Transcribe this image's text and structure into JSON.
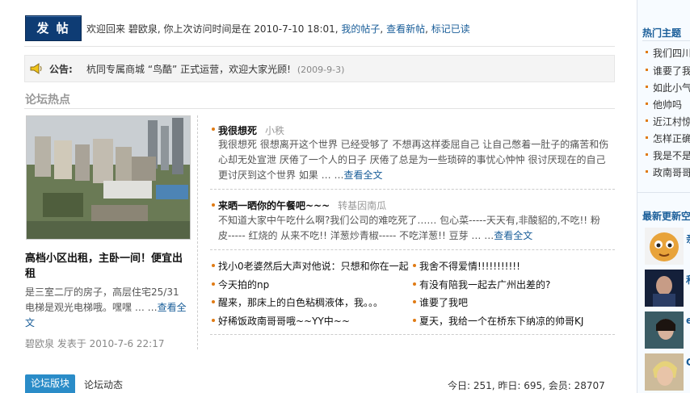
{
  "top": {
    "post_button": "发 帖",
    "welcome_prefix": "欢迎回来 碧欧泉, 你上次访问时间是在 2010-7-10 18:01,",
    "my_posts": "我的帖子",
    "new_posts": "查看新帖",
    "mark_read": "标记已读"
  },
  "announcement": {
    "label": "公告:",
    "text": "杭同专属商城 “鸟酷” 正式运营，欢迎大家光顾!",
    "date": "(2009-9-3)"
  },
  "hot": {
    "title": "论坛热点",
    "featured": {
      "title": "高档小区出租，主卧一间！便宜出租",
      "desc": "是三室二厅的房子，高层住宅25/31 电梯是观光电梯哦。嘿嘿 … …",
      "read_more": "查看全文",
      "meta": "碧欧泉 发表于 2010-7-6 22:17"
    },
    "articles": [
      {
        "title": "我很想死",
        "author": "小秩",
        "body": "我很想死 很想离开这个世界 已经受够了 不想再这样委屈自己 让自己憋着一肚子的痛苦和伤心却无处宣泄 厌倦了一个人的日子 厌倦了总是为一些琐碎的事忧心忡忡 很讨厌现在的自己 更讨厌到这个世界 如果 … …",
        "read_more": "查看全文"
      },
      {
        "title": "来晒一晒你的午餐吧~~~",
        "author": "转基因南瓜",
        "body": "不知道大家中午吃什么啊?我们公司的难吃死了…… 包心菜-----天天有,非酸貂的,不吃!! 粉皮----- 红烧的 从来不吃!! 洋葱炒青椒----- 不吃洋葱!! 豆芽 … …",
        "read_more": "查看全文"
      }
    ],
    "links_left": [
      "找小0老婆然后大声对他说：只想和你在一起",
      "今天拍的np",
      "醒来，那床上的白色粘稠液体，我。。。",
      "好稀饭政南哥哥哦~~YY中~~"
    ],
    "links_right": [
      "我舍不得爱情!!!!!!!!!!!",
      "有没有陪我一起去广州出差的?",
      "谁要了我吧",
      "夏天，我给一个在桥东下纳凉的帅哥KJ"
    ]
  },
  "footer": {
    "tab": "论坛版块",
    "news": "论坛动态",
    "stats": "今日: 251, 昨日: 695, 会员: 28707"
  },
  "sidebar": {
    "hot_topics_title": "热门主题",
    "hot_topics": [
      "我们四川",
      "谁要了我",
      "如此小气",
      "他帅吗",
      "近江村惊",
      "怎样正确",
      "我是不是",
      "政南哥哥"
    ],
    "new_title": "最新更新空",
    "new_initials": [
      "亲",
      "和",
      "e",
      "C"
    ]
  }
}
